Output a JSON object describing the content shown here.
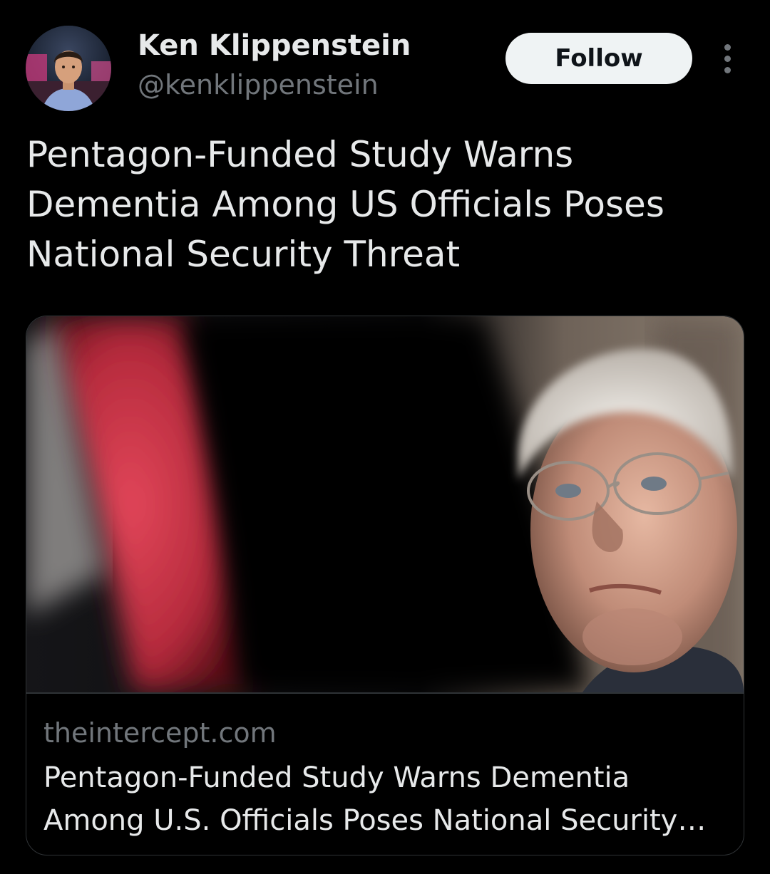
{
  "author": {
    "name": "Ken Klippenstein",
    "handle": "@kenklippenstein"
  },
  "actions": {
    "follow_label": "Follow"
  },
  "tweet": {
    "text": "Pentagon-Funded Study Warns Dementia Among US Officials Poses National Security Threat"
  },
  "link_card": {
    "domain": "theintercept.com",
    "title": "Pentagon-Funded Study Warns Dementia Among U.S. Officials Poses National Security Threat"
  },
  "colors": {
    "background": "#000000",
    "text_primary": "#e7e9ea",
    "text_secondary": "#71767b",
    "follow_button_bg": "#eff3f4",
    "border": "#2f3336"
  },
  "icons": {
    "more": "more-vertical-icon"
  }
}
